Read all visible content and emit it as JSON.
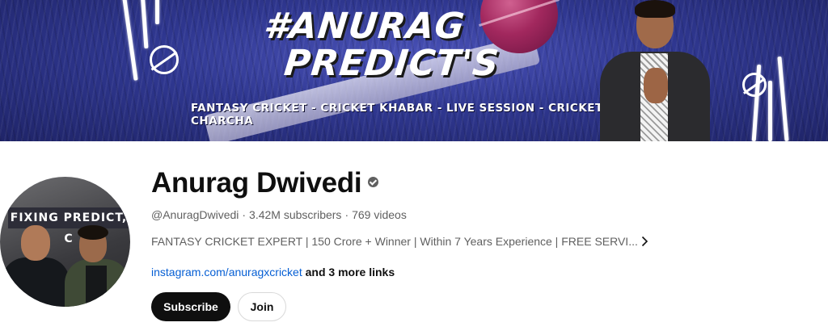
{
  "banner": {
    "title_line1": "#ANURAG",
    "title_line2": "PREDICT'S",
    "tagline": "FANTASY CRICKET - CRICKET KHABAR - LIVE SESSION - CRICKET CHARCHA",
    "colors": {
      "background": "#2f3790",
      "accent": "#a2285e"
    }
  },
  "avatar": {
    "sign_text": "FIXING PREDICT, C"
  },
  "channel": {
    "name": "Anurag Dwivedi",
    "verified_icon": "verified-check-icon",
    "handle": "@AnuragDwivedi",
    "separator": "·",
    "subscribers": "3.42M subscribers",
    "videos": "769 videos",
    "description": "FANTASY CRICKET EXPERT | 150 Crore + Winner | Within 7 Years Experience | FREE SERVI...",
    "more_icon": "chevron-right-icon",
    "link": "instagram.com/anuragxcricket",
    "more_links": "and 3 more links"
  },
  "actions": {
    "subscribe_label": "Subscribe",
    "join_label": "Join"
  }
}
